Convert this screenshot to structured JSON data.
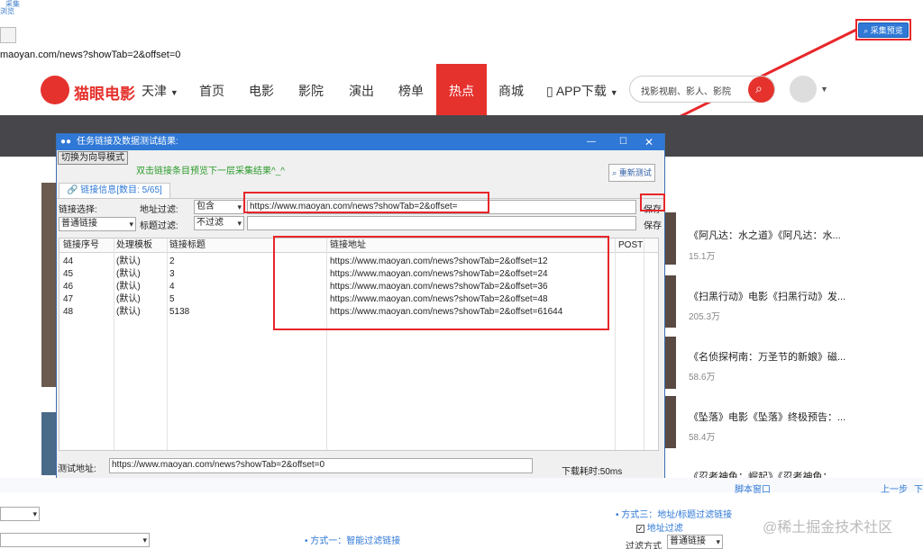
{
  "top": {
    "frag1": "采集",
    "frag2": "浏览",
    "url": "maoyan.com/news?showTab=2&offset=0",
    "preview_btn": "采集预览"
  },
  "maoyan": {
    "logo": "猫眼电影",
    "city": "天津",
    "nav": [
      "首页",
      "电影",
      "影院",
      "演出",
      "榜单",
      "热点",
      "商城",
      "APP下载"
    ],
    "search_placeholder": "找影视剧、影人、影院"
  },
  "news": {
    "items": [
      {
        "title": "《阿凡达：水之道》《阿凡达：水...",
        "count": "15.1万"
      },
      {
        "title": "《扫黑行动》电影《扫黑行动》发...",
        "count": "205.3万"
      },
      {
        "title": "《名侦探柯南：万圣节的新娘》磁...",
        "count": "58.6万"
      },
      {
        "title": "《坠落》电影《坠落》终极预告：...",
        "count": "58.4万"
      },
      {
        "title": "《忍者神龟：崛起》《忍者神龟：...",
        "count": ""
      }
    ]
  },
  "dialog": {
    "title": "任务链接及数据测试结果:",
    "mode_button": "切换为向导模式",
    "hint": "双击链接条目预览下一层采集结果^_^",
    "retest_button": "重新测试",
    "tab_label": "链接信息[数目: 5/65]",
    "link_select_label": "链接选择:",
    "link_select_value": "普通链接",
    "addr_filter_label": "地址过滤:",
    "addr_filter_mode": "包含",
    "addr_filter_value": "https://www.maoyan.com/news?showTab=2&offset=",
    "title_filter_label": "标题过滤:",
    "title_filter_mode": "不过滤",
    "save1": "保存",
    "save2": "保存",
    "columns": [
      "链接序号",
      "处理模板",
      "链接标题",
      "链接地址",
      "POST"
    ],
    "rows": [
      [
        "44",
        "(默认)",
        "2",
        "https://www.maoyan.com/news?showTab=2&offset=12",
        ""
      ],
      [
        "45",
        "(默认)",
        "3",
        "https://www.maoyan.com/news?showTab=2&offset=24",
        ""
      ],
      [
        "46",
        "(默认)",
        "4",
        "https://www.maoyan.com/news?showTab=2&offset=36",
        ""
      ],
      [
        "47",
        "(默认)",
        "5",
        "https://www.maoyan.com/news?showTab=2&offset=48",
        ""
      ],
      [
        "48",
        "(默认)",
        "5138",
        "https://www.maoyan.com/news?showTab=2&offset=61644",
        ""
      ]
    ],
    "test_url_label": "测试地址:",
    "test_url_value": "https://www.maoyan.com/news?showTab=2&offset=0",
    "download_time": "下载耗时:50ms"
  },
  "bottom": {
    "script_window": "脚本窗口",
    "prev_step": "上一步",
    "next_frag": "下",
    "way1": "方式一：智能过滤链接",
    "way3": "方式三：地址/标题过滤链接",
    "addr_filter": "地址过滤",
    "filter_way_label": "过滤方式",
    "filter_way_value": "普通链接",
    "watermark": "@稀土掘金技术社区"
  }
}
